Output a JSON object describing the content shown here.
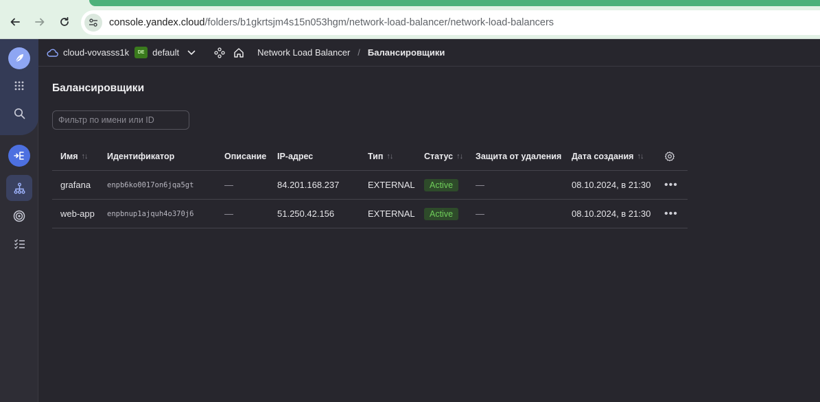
{
  "browser": {
    "url_host": "console.yandex.cloud",
    "url_path": "/folders/b1gkrtsjm4s15n053hgm/network-load-balancer/network-load-balancers"
  },
  "rail": {
    "icons": [
      "logo-icon",
      "apps-grid-icon",
      "search-icon",
      "load-balancer-service-icon",
      "balancers-icon",
      "target-icon",
      "checklist-icon"
    ]
  },
  "header": {
    "cloud_name": "cloud-vovasss1k",
    "folder_badge": "DE",
    "folder_name": "default",
    "breadcrumb_service": "Network Load Balancer",
    "breadcrumb_separator": "/",
    "breadcrumb_current": "Балансировщики"
  },
  "main": {
    "title": "Балансировщики",
    "filter_placeholder": "Фильтр по имени или ID",
    "columns": {
      "name": "Имя",
      "id": "Идентификатор",
      "description": "Описание",
      "ip": "IP-адрес",
      "type": "Тип",
      "status": "Статус",
      "protection": "Защита от удаления",
      "created": "Дата создания"
    },
    "sort_glyph": "↑↓",
    "rows": [
      {
        "name": "grafana",
        "id": "enpb6ko0017on6jqa5gt",
        "description": "—",
        "ip": "84.201.168.237",
        "type": "EXTERNAL",
        "status": "Active",
        "protection": "—",
        "created": "08.10.2024, в 21:30",
        "actions": "•••"
      },
      {
        "name": "web-app",
        "id": "enpbnup1ajquh4o370j6",
        "description": "—",
        "ip": "51.250.42.156",
        "type": "EXTERNAL",
        "status": "Active",
        "protection": "—",
        "created": "08.10.2024, в 21:30",
        "actions": "•••"
      }
    ]
  },
  "colors": {
    "background": "#27262d",
    "rail": "#2e2d35",
    "accent": "#4d70e0",
    "status_active_bg": "#2e4b2a",
    "status_active_text": "#6fce5a",
    "browser_chrome": "#e3f2e6"
  }
}
